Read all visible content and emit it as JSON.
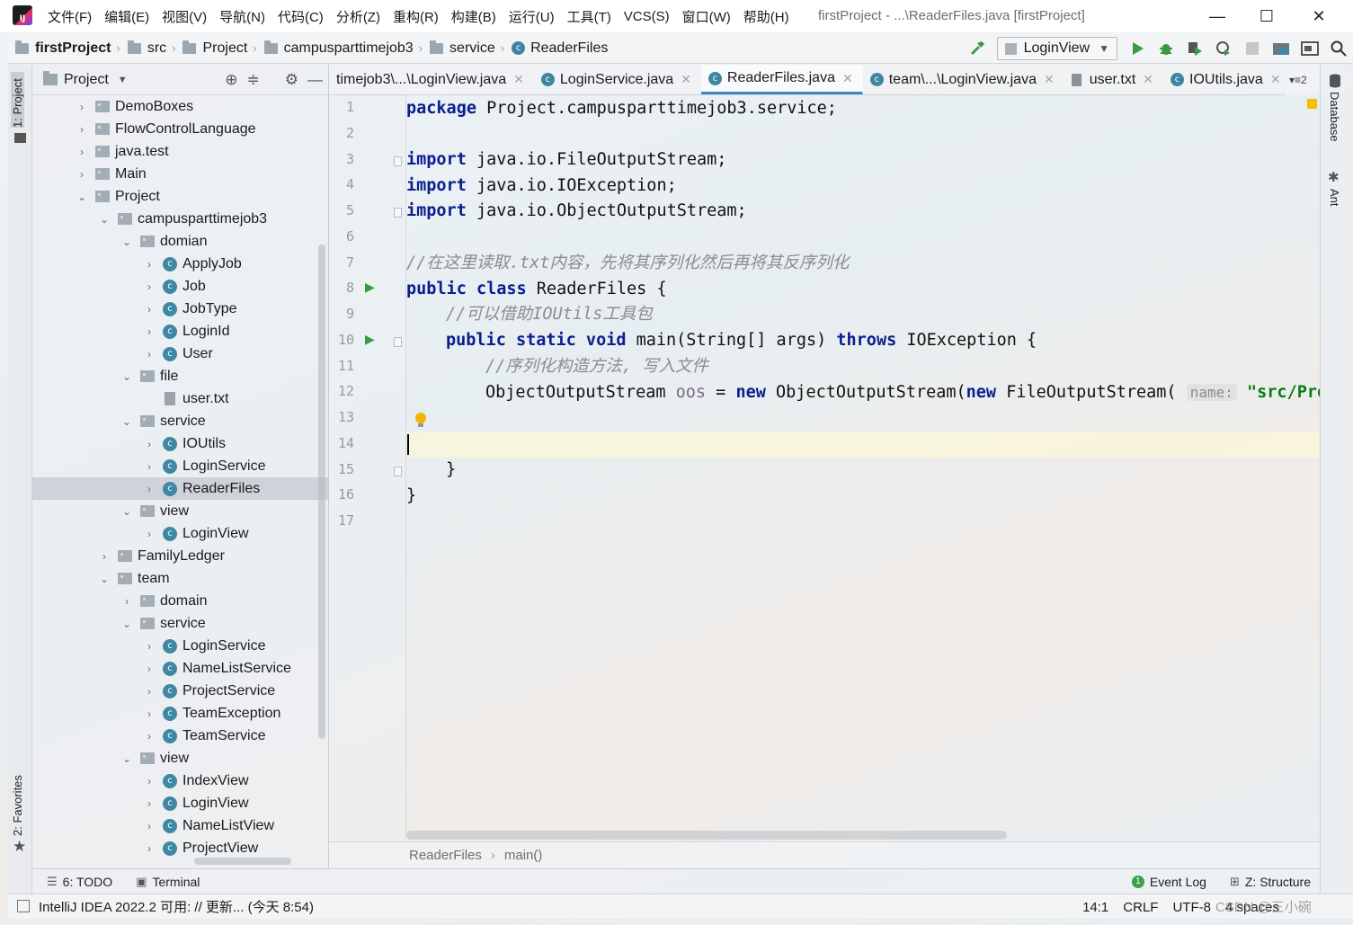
{
  "window": {
    "logo_text": "IJ",
    "title": "firstProject - ...\\ReaderFiles.java [firstProject]",
    "menu": [
      "文件(F)",
      "编辑(E)",
      "视图(V)",
      "导航(N)",
      "代码(C)",
      "分析(Z)",
      "重构(R)",
      "构建(B)",
      "运行(U)",
      "工具(T)",
      "VCS(S)",
      "窗口(W)",
      "帮助(H)"
    ],
    "controls": {
      "minimize": "—",
      "maximize": "☐",
      "close": "✕"
    }
  },
  "navbar": {
    "crumbs": [
      "firstProject",
      "src",
      "Project",
      "campusparttimejob3",
      "service",
      "ReaderFiles"
    ],
    "run_config": "LoginView",
    "icons": [
      "hammer-icon",
      "run-icon",
      "debug-icon",
      "coverage-icon",
      "profile-icon",
      "stop-icon",
      "project-structure-icon",
      "sdk-icon",
      "search-icon"
    ]
  },
  "left_stripe": {
    "project_tab": "1: Project",
    "favorites_tab": "2: Favorites"
  },
  "project_panel": {
    "title": "Project",
    "tree": [
      {
        "label": "DemoBoxes",
        "level": 0,
        "kind": "package",
        "state": "collapsed"
      },
      {
        "label": "FlowControlLanguage",
        "level": 0,
        "kind": "package",
        "state": "collapsed"
      },
      {
        "label": "java.test",
        "level": 0,
        "kind": "package",
        "state": "collapsed"
      },
      {
        "label": "Main",
        "level": 0,
        "kind": "package",
        "state": "collapsed"
      },
      {
        "label": "Project",
        "level": 0,
        "kind": "package",
        "state": "expanded"
      },
      {
        "label": "campusparttimejob3",
        "level": 1,
        "kind": "package",
        "state": "expanded"
      },
      {
        "label": "domian",
        "level": 2,
        "kind": "package",
        "state": "expanded"
      },
      {
        "label": "ApplyJob",
        "level": 3,
        "kind": "class",
        "state": "collapsed"
      },
      {
        "label": "Job",
        "level": 3,
        "kind": "class",
        "state": "collapsed"
      },
      {
        "label": "JobType",
        "level": 3,
        "kind": "class",
        "state": "collapsed"
      },
      {
        "label": "LoginId",
        "level": 3,
        "kind": "class",
        "state": "collapsed"
      },
      {
        "label": "User",
        "level": 3,
        "kind": "class",
        "state": "collapsed"
      },
      {
        "label": "file",
        "level": 2,
        "kind": "package",
        "state": "expanded"
      },
      {
        "label": "user.txt",
        "level": 3,
        "kind": "file",
        "state": "none"
      },
      {
        "label": "service",
        "level": 2,
        "kind": "package",
        "state": "expanded"
      },
      {
        "label": "IOUtils",
        "level": 3,
        "kind": "class",
        "state": "collapsed"
      },
      {
        "label": "LoginService",
        "level": 3,
        "kind": "class",
        "state": "collapsed"
      },
      {
        "label": "ReaderFiles",
        "level": 3,
        "kind": "class",
        "state": "collapsed",
        "selected": true
      },
      {
        "label": "view",
        "level": 2,
        "kind": "package",
        "state": "expanded"
      },
      {
        "label": "LoginView",
        "level": 3,
        "kind": "class",
        "state": "collapsed"
      },
      {
        "label": "FamilyLedger",
        "level": 1,
        "kind": "package",
        "state": "collapsed"
      },
      {
        "label": "team",
        "level": 1,
        "kind": "package",
        "state": "expanded"
      },
      {
        "label": "domain",
        "level": 2,
        "kind": "package",
        "state": "collapsed"
      },
      {
        "label": "service",
        "level": 2,
        "kind": "package",
        "state": "expanded"
      },
      {
        "label": "LoginService",
        "level": 3,
        "kind": "class",
        "state": "collapsed"
      },
      {
        "label": "NameListService",
        "level": 3,
        "kind": "class",
        "state": "collapsed"
      },
      {
        "label": "ProjectService",
        "level": 3,
        "kind": "class",
        "state": "collapsed"
      },
      {
        "label": "TeamException",
        "level": 3,
        "kind": "class",
        "state": "collapsed"
      },
      {
        "label": "TeamService",
        "level": 3,
        "kind": "class",
        "state": "collapsed"
      },
      {
        "label": "view",
        "level": 2,
        "kind": "package",
        "state": "expanded"
      },
      {
        "label": "IndexView",
        "level": 3,
        "kind": "class",
        "state": "collapsed"
      },
      {
        "label": "LoginView",
        "level": 3,
        "kind": "class",
        "state": "collapsed"
      },
      {
        "label": "NameListView",
        "level": 3,
        "kind": "class",
        "state": "collapsed"
      },
      {
        "label": "ProjectView",
        "level": 3,
        "kind": "class",
        "state": "collapsed"
      }
    ]
  },
  "editor_tabs": {
    "tabs": [
      {
        "label": "timejob3\\...\\LoginView.java",
        "icon": "none",
        "active": false
      },
      {
        "label": "LoginService.java",
        "icon": "class",
        "active": false
      },
      {
        "label": "ReaderFiles.java",
        "icon": "class",
        "active": true
      },
      {
        "label": "team\\...\\LoginView.java",
        "icon": "class",
        "active": false
      },
      {
        "label": "user.txt",
        "icon": "text",
        "active": false
      },
      {
        "label": "IOUtils.java",
        "icon": "class",
        "active": false
      }
    ],
    "overflow": "▾≡2"
  },
  "right_stripe": {
    "database_tab": "Database",
    "ant_tab": "Ant"
  },
  "editor": {
    "lines": [
      "1",
      "2",
      "3",
      "4",
      "5",
      "6",
      "7",
      "8",
      "9",
      "10",
      "11",
      "12",
      "13",
      "14",
      "15",
      "16",
      "17"
    ],
    "code": {
      "l1_kw": "package",
      "l1_rest": " Project.campusparttimejob3.service;",
      "l3_kw": "import",
      "l3_rest": " java.io.FileOutputStream;",
      "l4_kw": "import",
      "l4_rest": " java.io.IOException;",
      "l5_kw": "import",
      "l5_rest": " java.io.ObjectOutputStream;",
      "l7_comment": "//在这里读取.txt内容，先将其序列化然后再将其反序列化",
      "l8_kw": "public class",
      "l8_rest": " ReaderFiles {",
      "l9_comment": "//可以借助IOUtils工具包",
      "l10_kw1": "public static void",
      "l10_mid": " main(String[] args) ",
      "l10_kw2": "throws",
      "l10_rest": " IOException {",
      "l11_comment": "//序列化构造方法, 写入文件",
      "l12_a": "ObjectOutputStream ",
      "l12_var": "oos",
      "l12_b": " = ",
      "l12_kw1": "new",
      "l12_c": " ObjectOutputStream(",
      "l12_kw2": "new",
      "l12_d": " FileOutputStream( ",
      "l12_hint": "name:",
      "l12_str": " \"src/Proj",
      "l15": "}",
      "l16": "}"
    },
    "breadcrumb": [
      "ReaderFiles",
      "main()"
    ]
  },
  "bottom_tools": {
    "todo": "6: TODO",
    "terminal": "Terminal",
    "event_log_count": "1",
    "event_log": "Event Log",
    "structure": "Z: Structure"
  },
  "statusbar": {
    "message": "IntelliJ IDEA 2022.2 可用: // 更新... (今天 8:54)",
    "position": "14:1",
    "line_sep": "CRLF",
    "encoding": "UTF-8",
    "indent": "4 spaces",
    "watermark": "CSDN @三小碗"
  }
}
